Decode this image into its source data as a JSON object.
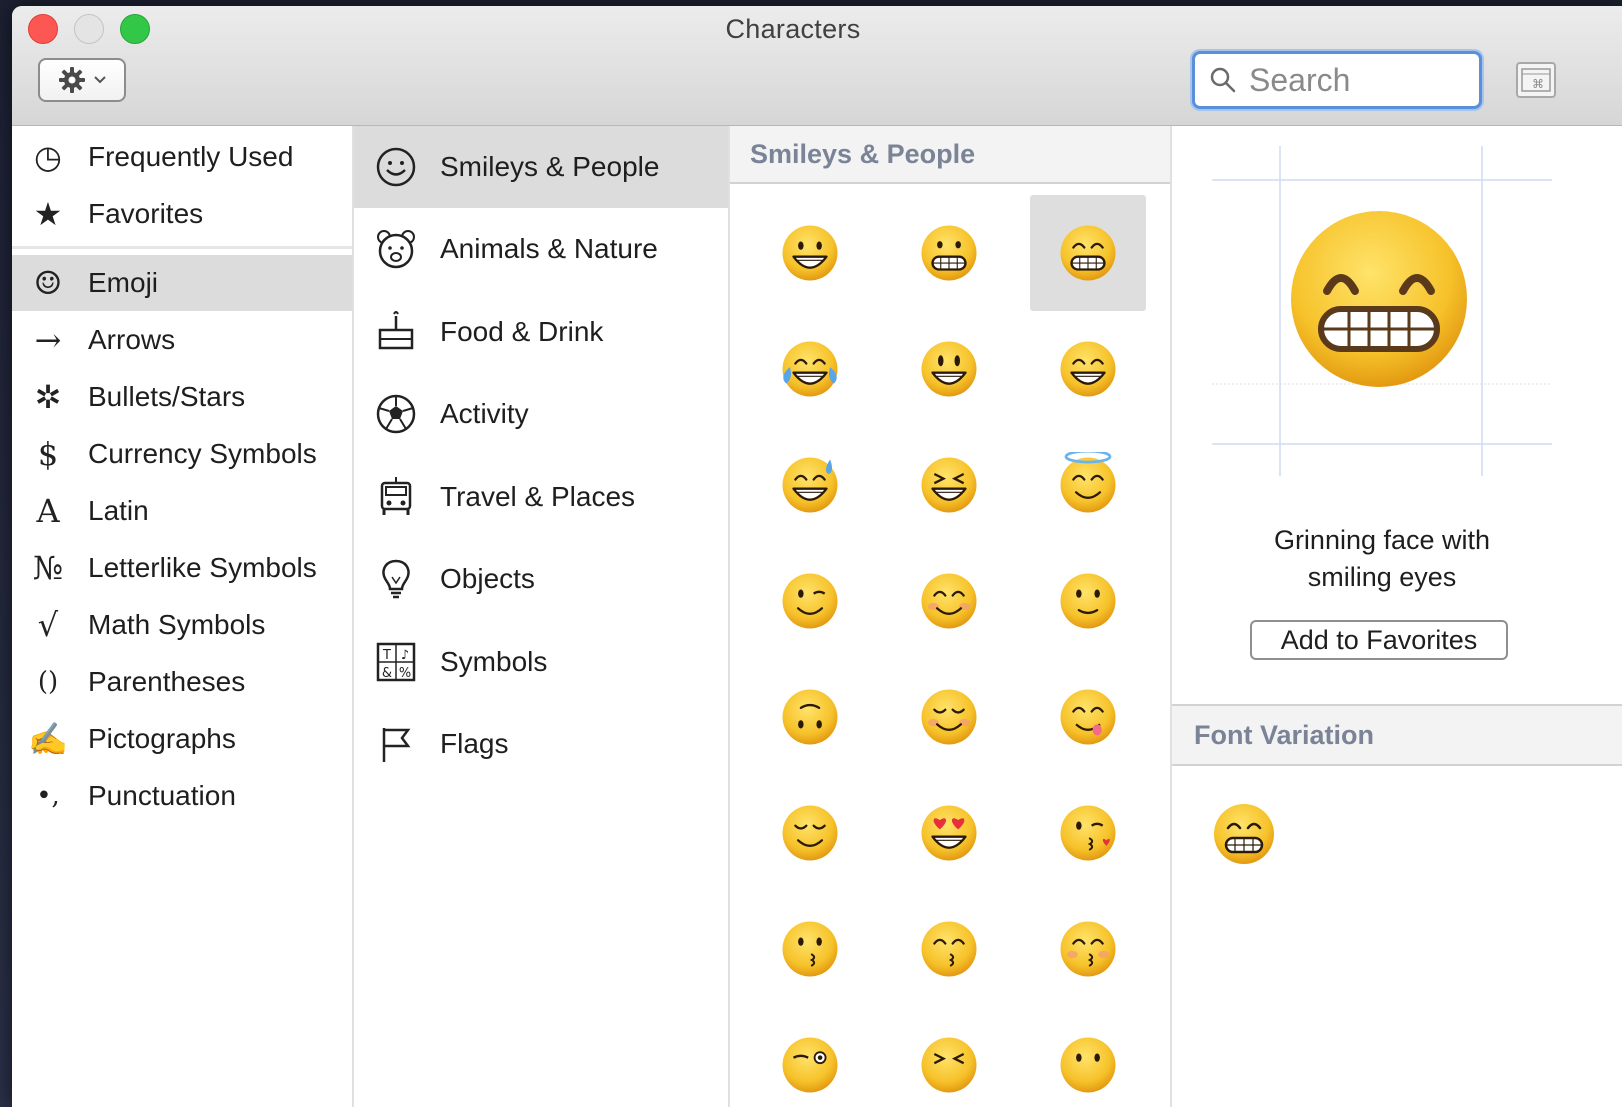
{
  "window": {
    "title": "Characters"
  },
  "toolbar": {
    "search_placeholder": "Search",
    "action_icon": "gear-icon",
    "keyboard_viewer_icon": "keyboard-viewer-icon"
  },
  "sidebar": {
    "items": [
      {
        "label": "Frequently Used",
        "icon": "clock-icon",
        "glyph": "◷"
      },
      {
        "label": "Favorites",
        "icon": "star-icon",
        "glyph": "★"
      },
      {
        "label": "Emoji",
        "icon": "smiley-icon",
        "glyph": "☺",
        "selected": true
      },
      {
        "label": "Arrows",
        "icon": "arrow-icon",
        "glyph": "→"
      },
      {
        "label": "Bullets/Stars",
        "icon": "asterisk-icon",
        "glyph": "✲"
      },
      {
        "label": "Currency Symbols",
        "icon": "dollar-icon",
        "glyph": "$"
      },
      {
        "label": "Latin",
        "icon": "latin-a-icon",
        "glyph": "A"
      },
      {
        "label": "Letterlike Symbols",
        "icon": "numero-icon",
        "glyph": "№"
      },
      {
        "label": "Math Symbols",
        "icon": "square-root-icon",
        "glyph": "√"
      },
      {
        "label": "Parentheses",
        "icon": "parentheses-icon",
        "glyph": "()"
      },
      {
        "label": "Pictographs",
        "icon": "writing-hand-icon",
        "glyph": "✍"
      },
      {
        "label": "Punctuation",
        "icon": "punctuation-icon",
        "glyph": "•,"
      }
    ]
  },
  "categories": {
    "items": [
      {
        "label": "Smileys & People",
        "icon": "smiley-outline-icon",
        "selected": true
      },
      {
        "label": "Animals & Nature",
        "icon": "bear-icon"
      },
      {
        "label": "Food & Drink",
        "icon": "cake-icon"
      },
      {
        "label": "Activity",
        "icon": "soccer-ball-icon"
      },
      {
        "label": "Travel & Places",
        "icon": "car-icon"
      },
      {
        "label": "Objects",
        "icon": "lightbulb-icon"
      },
      {
        "label": "Symbols",
        "icon": "symbols-icon"
      },
      {
        "label": "Flags",
        "icon": "flag-icon"
      }
    ]
  },
  "grid": {
    "header": "Smileys & People",
    "selected_index": 2
  },
  "detail": {
    "name": "Grinning face with smiling eyes",
    "name_line1": "Grinning face with",
    "name_line2": "smiling eyes",
    "add_favorites_label": "Add to Favorites",
    "font_variation_header": "Font Variation"
  },
  "colors": {
    "accent": "#5b8fd8",
    "emoji_face": "#f7c42d",
    "selection": "#dcdcdc",
    "section_header_text": "#7a8496"
  }
}
